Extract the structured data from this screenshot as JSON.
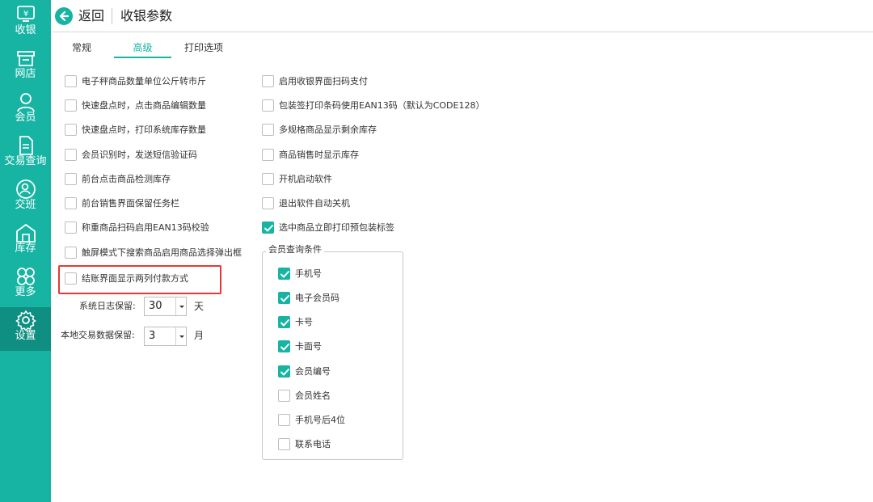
{
  "colors": {
    "accent": "#17b4a3",
    "accent_dark": "#0f8f81",
    "highlight": "#e53935"
  },
  "sidebar": {
    "items": [
      {
        "label": "收银",
        "icon": "cashier-icon",
        "active": false
      },
      {
        "label": "网店",
        "icon": "shop-icon",
        "active": false
      },
      {
        "label": "会员",
        "icon": "member-icon",
        "active": false
      },
      {
        "label": "交易查询",
        "icon": "document-icon",
        "active": false
      },
      {
        "label": "交班",
        "icon": "shift-handover-icon",
        "active": false
      },
      {
        "label": "库存",
        "icon": "warehouse-icon",
        "active": false
      },
      {
        "label": "更多",
        "icon": "more-icon",
        "active": false
      },
      {
        "label": "设置",
        "icon": "gear-icon",
        "active": true
      }
    ]
  },
  "header": {
    "back_label": "返回",
    "title": "收银参数"
  },
  "tabs": [
    {
      "label": "常规",
      "active": false
    },
    {
      "label": "高级",
      "active": true
    },
    {
      "label": "打印选项",
      "active": false
    }
  ],
  "left_options": [
    {
      "label": "电子秤商品数量单位公斤转市斤",
      "checked": false
    },
    {
      "label": "快速盘点时，点击商品编辑数量",
      "checked": false
    },
    {
      "label": "快速盘点时，打印系统库存数量",
      "checked": false
    },
    {
      "label": "会员识别时，发送短信验证码",
      "checked": false
    },
    {
      "label": "前台点击商品检测库存",
      "checked": false
    },
    {
      "label": "前台销售界面保留任务栏",
      "checked": false
    },
    {
      "label": "称重商品扫码启用EAN13码校验",
      "checked": false
    },
    {
      "label": "触屏模式下搜索商品启用商品选择弹出框",
      "checked": false
    },
    {
      "label": "结账界面显示两列付款方式",
      "checked": false
    }
  ],
  "right_options": [
    {
      "label": "启用收银界面扫码支付",
      "checked": false
    },
    {
      "label": "包装签打印条码使用EAN13码（默认为CODE128）",
      "checked": false
    },
    {
      "label": "多规格商品显示剩余库存",
      "checked": false
    },
    {
      "label": "商品销售时显示库存",
      "checked": false
    },
    {
      "label": "开机启动软件",
      "checked": false
    },
    {
      "label": "退出软件自动关机",
      "checked": false
    },
    {
      "label": "选中商品立即打印预包装标签",
      "checked": true
    }
  ],
  "log_retention": {
    "label": "系统日志保留:",
    "value": "30",
    "unit": "天"
  },
  "trade_retention": {
    "label": "本地交易数据保留:",
    "value": "3",
    "unit": "月"
  },
  "member_query": {
    "title": "会员查询条件",
    "options": [
      {
        "label": "手机号",
        "checked": true
      },
      {
        "label": "电子会员码",
        "checked": true
      },
      {
        "label": "卡号",
        "checked": true
      },
      {
        "label": "卡面号",
        "checked": true
      },
      {
        "label": "会员编号",
        "checked": true
      },
      {
        "label": "会员姓名",
        "checked": false
      },
      {
        "label": "手机号后4位",
        "checked": false
      },
      {
        "label": "联系电话",
        "checked": false
      }
    ]
  }
}
